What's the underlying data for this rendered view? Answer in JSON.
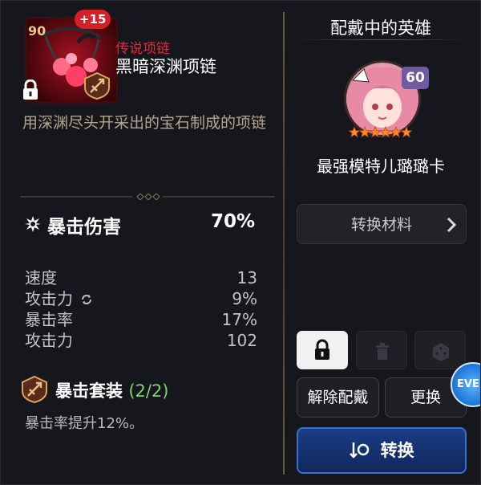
{
  "item": {
    "level": "90",
    "enhance": "+15",
    "grade": "传说项链",
    "name": "黑暗深渊项链",
    "description": "用深渊尽头开采出的宝石制成的项链",
    "locked": true
  },
  "main_stat": {
    "name": "暴击伤害",
    "value": "70%"
  },
  "substats": [
    {
      "name": "速度",
      "value": "13",
      "reforged": false
    },
    {
      "name": "攻击力",
      "value": "9%",
      "reforged": true
    },
    {
      "name": "暴击率",
      "value": "17%",
      "reforged": false
    },
    {
      "name": "攻击力",
      "value": "102",
      "reforged": false
    }
  ],
  "set": {
    "name": "暴击套装",
    "count": "(2/2)",
    "effect": "暴击率提升12%。"
  },
  "hero_panel": {
    "title": "配戴中的英雄",
    "hero_level": "60",
    "hero_name": "最强模特儿璐璐卡",
    "stars": 6
  },
  "buttons": {
    "convert_materials": "转换材料",
    "unequip": "解除配戴",
    "change": "更换",
    "convert": "转换",
    "event": "EVEN"
  },
  "colors": {
    "grade": "#e8283a",
    "set_count": "#7ed36b",
    "accent_blue": "#3a6fd4"
  }
}
